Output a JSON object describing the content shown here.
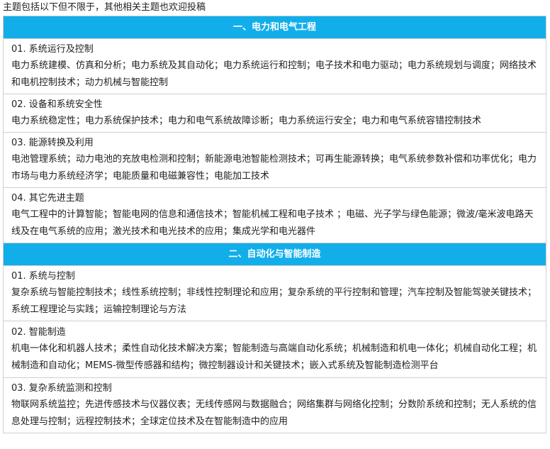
{
  "intro": "主题包括以下但不限于，其他相关主题也欢迎投稿",
  "sections": [
    {
      "title": "一、电力和电气工程",
      "topics": [
        {
          "title": "01. 系统运行及控制",
          "body": "电力系统建模、仿真和分析；电力系统及其自动化；电力系统运行和控制；电子技术和电力驱动；电力系统规划与调度；网络技术和电机控制技术；动力机械与智能控制"
        },
        {
          "title": "02. 设备和系统安全性",
          "body": "电力系统稳定性；电力系统保护技术；电力和电气系统故障诊断；电力系统运行安全；电力和电气系统容错控制技术"
        },
        {
          "title": "03. 能源转换及利用",
          "body": "电池管理系统；动力电池的充放电检测和控制；新能源电池智能检测技术；可再生能源转换；电气系统参数补偿和功率优化；电力市场与电力系统经济学；电能质量和电磁兼容性；电能加工技术"
        },
        {
          "title": "04. 其它先进主题",
          "body": "电气工程中的计算智能；智能电网的信息和通信技术；智能机械工程和电子技术 ；电磁、光子学与绿色能源；微波/毫米波电路天线及在电气系统的应用；激光技术和电光技术的应用；集成光学和电光器件"
        }
      ]
    },
    {
      "title": "二、自动化与智能制造",
      "topics": [
        {
          "title": "01. 系统与控制",
          "body": "复杂系统与智能控制技术；线性系统控制；非线性控制理论和应用；复杂系统的平行控制和管理；汽车控制及智能驾驶关键技术；系统工程理论与实践；运输控制理论与方法"
        },
        {
          "title": "02. 智能制造",
          "body": "机电一体化和机器人技术；柔性自动化技术解决方案；智能制造与高端自动化系统；机械制造和机电一体化；机械自动化工程；机械制造和自动化；MEMS-微型传感器和结构；微控制器设计和关键技术；嵌入式系统及智能制造检测平台"
        },
        {
          "title": "03. 复杂系统监测和控制",
          "body": "物联网系统监控；先进传感技术与仪器仪表；无线传感网与数据融合；网络集群与网络化控制；分数阶系统和控制；无人系统的信息处理与控制；远程控制技术；全球定位技术及在智能制造中的应用"
        }
      ]
    }
  ]
}
